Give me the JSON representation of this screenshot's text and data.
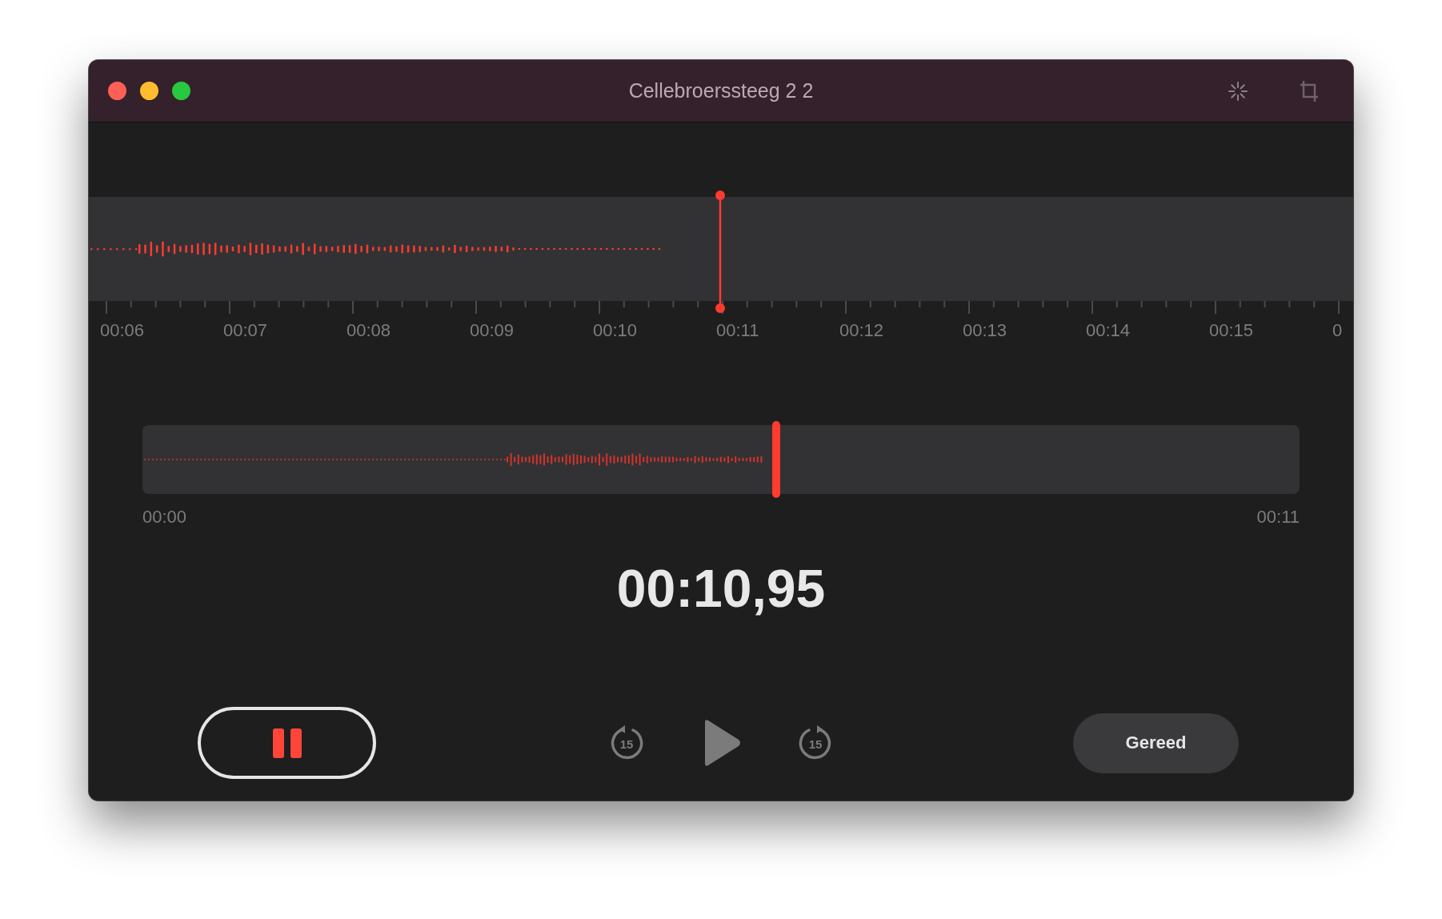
{
  "window": {
    "title": "Cellebroerssteeg 2 2"
  },
  "timeline": {
    "labels": [
      "00:06",
      "00:07",
      "00:08",
      "00:09",
      "00:10",
      "00:11",
      "00:12",
      "00:13",
      "00:14",
      "00:15",
      "0"
    ]
  },
  "scrubber": {
    "level": 0.548,
    "start": "00:00",
    "end": "00:11"
  },
  "elapsed": "00:10,95",
  "controls": {
    "skip_back": "15",
    "skip_forward": "15",
    "done": "Gereed"
  }
}
